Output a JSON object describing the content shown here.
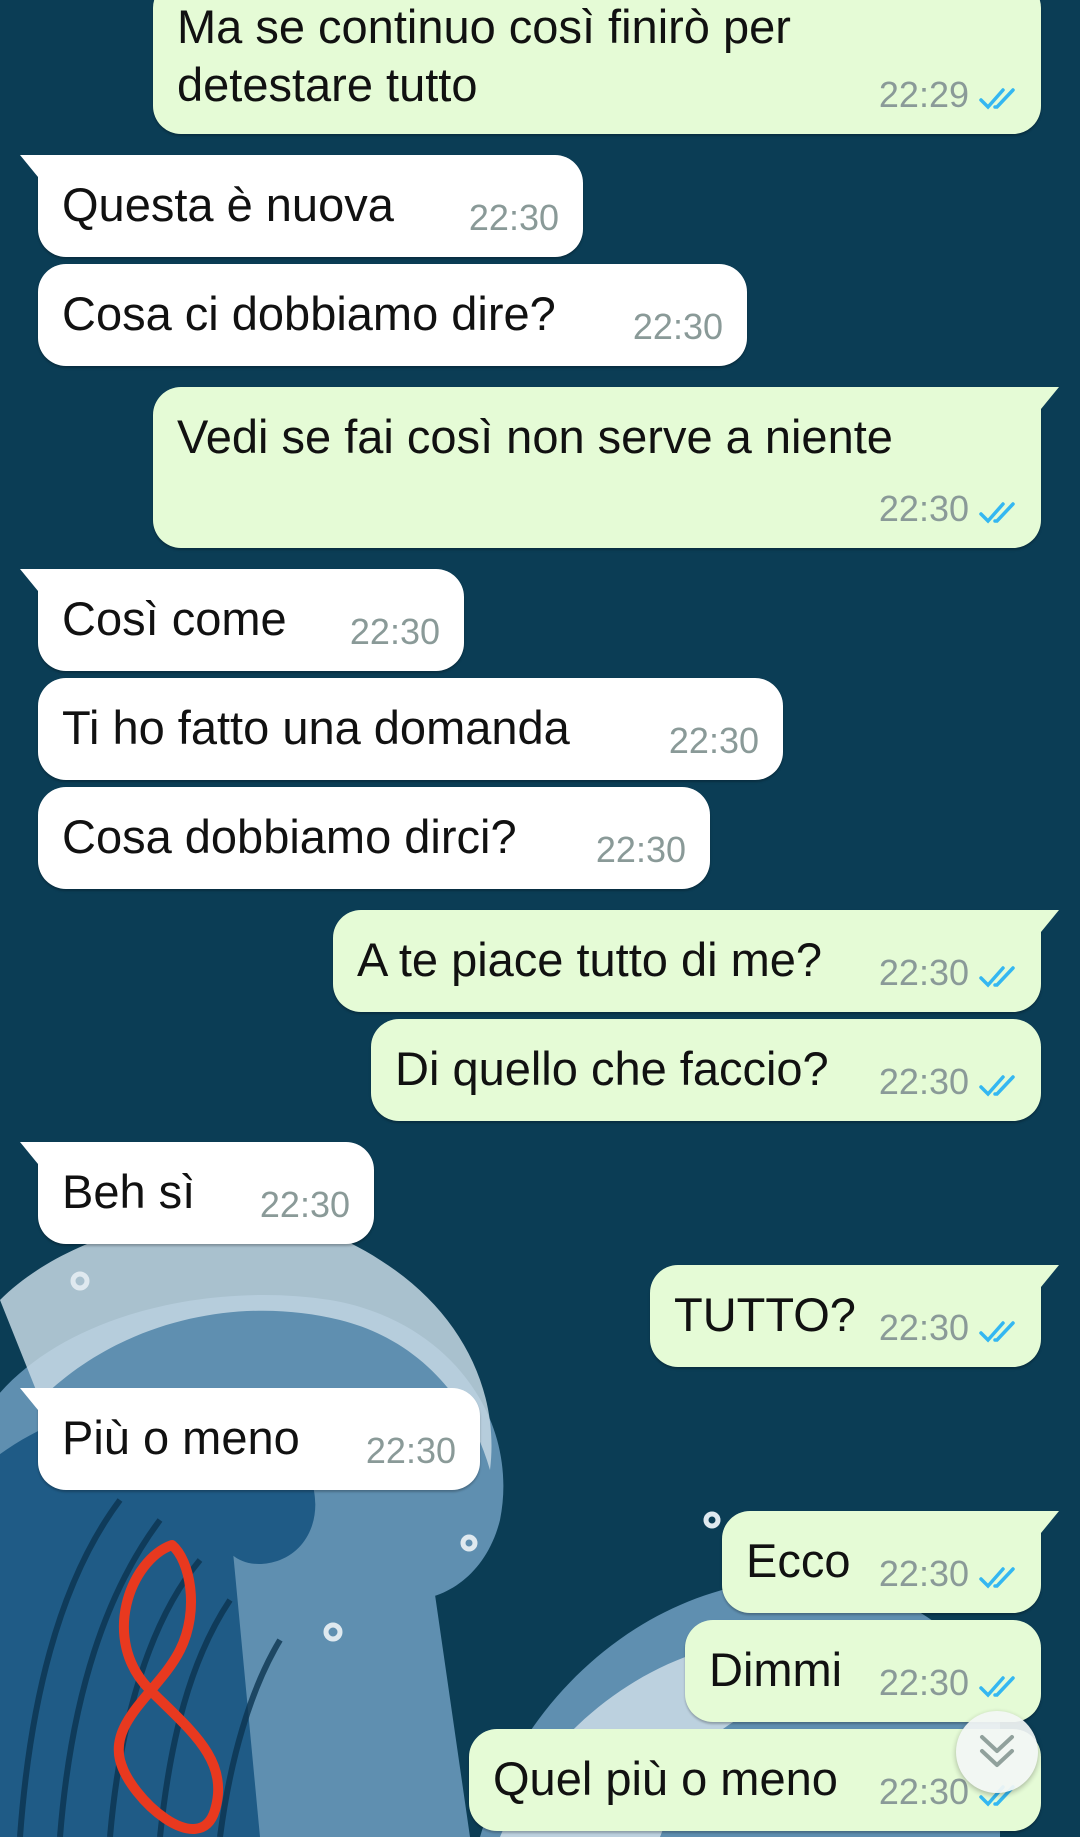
{
  "messages": [
    {
      "dir": "out",
      "text": "Ma se continuo così finirò per\ndetestare tutto",
      "time": "22:29",
      "read": true
    },
    {
      "dir": "in",
      "text": "Questa è nuova",
      "time": "22:30"
    },
    {
      "dir": "in",
      "text": "Cosa ci dobbiamo dire?",
      "time": "22:30"
    },
    {
      "dir": "out",
      "text": "Vedi se fai così non serve a niente",
      "time": "22:30",
      "read": true
    },
    {
      "dir": "in",
      "text": "Così come",
      "time": "22:30"
    },
    {
      "dir": "in",
      "text": "Ti ho fatto una domanda",
      "time": "22:30"
    },
    {
      "dir": "in",
      "text": "Cosa dobbiamo dirci?",
      "time": "22:30"
    },
    {
      "dir": "out",
      "text": "A te piace tutto di me?",
      "time": "22:30",
      "read": true
    },
    {
      "dir": "out",
      "text": "Di quello che faccio?",
      "time": "22:30",
      "read": true
    },
    {
      "dir": "in",
      "text": "Beh sì",
      "time": "22:30"
    },
    {
      "dir": "out",
      "text": "TUTTO?",
      "time": "22:30",
      "read": true
    },
    {
      "dir": "in",
      "text": "Più o meno",
      "time": "22:30"
    },
    {
      "dir": "out",
      "text": "Ecco",
      "time": "22:30",
      "read": true
    },
    {
      "dir": "out",
      "text": "Dimmi",
      "time": "22:30",
      "read": true
    },
    {
      "dir": "out",
      "text": "Quel più o meno",
      "time": "22:30",
      "read": true
    }
  ],
  "colors": {
    "wallpaper": "#0b3d55",
    "incoming_bubble": "#ffffff",
    "outgoing_bubble": "#e5fbd6",
    "read_ticks": "#34b7f1",
    "timestamp": "#8a9a98",
    "annotation": "#e8391f"
  },
  "icons": {
    "read_receipt": "double-check-icon",
    "scroll_down": "double-chevron-down-icon"
  }
}
